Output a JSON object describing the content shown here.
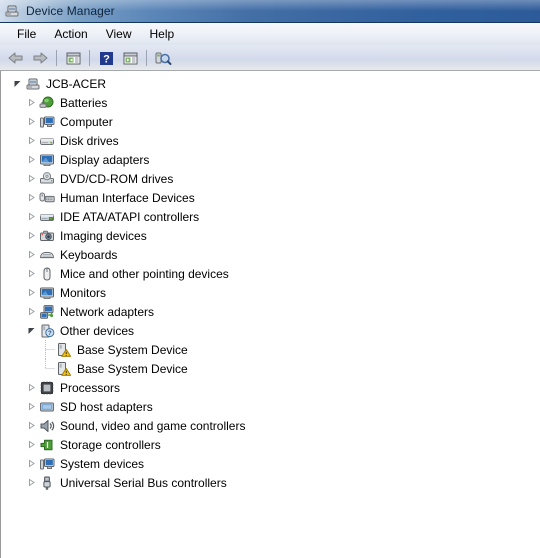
{
  "window": {
    "title": "Device Manager",
    "title_icon": "device-manager-icon"
  },
  "menubar": {
    "items": [
      {
        "label": "File",
        "name": "menu-file"
      },
      {
        "label": "Action",
        "name": "menu-action"
      },
      {
        "label": "View",
        "name": "menu-view"
      },
      {
        "label": "Help",
        "name": "menu-help"
      }
    ]
  },
  "toolbar": {
    "buttons": [
      {
        "icon": "back-arrow-icon",
        "tooltip": "Back"
      },
      {
        "icon": "forward-arrow-icon",
        "tooltip": "Forward"
      },
      {
        "icon": "show-hide-console-tree-icon",
        "tooltip": "Show/Hide Console Tree"
      },
      {
        "icon": "help-icon",
        "tooltip": "Help"
      },
      {
        "icon": "properties-icon",
        "tooltip": "Properties"
      },
      {
        "icon": "scan-hardware-changes-icon",
        "tooltip": "Scan for hardware changes"
      }
    ]
  },
  "tree": {
    "root": {
      "label": "JCB-ACER",
      "icon": "computer-root-icon",
      "expanded": true
    },
    "items": [
      {
        "label": "Batteries",
        "icon": "battery-icon",
        "expanded": false,
        "level": 1
      },
      {
        "label": "Computer",
        "icon": "computer-icon",
        "expanded": false,
        "level": 1
      },
      {
        "label": "Disk drives",
        "icon": "disk-drive-icon",
        "expanded": false,
        "level": 1
      },
      {
        "label": "Display adapters",
        "icon": "display-adapter-icon",
        "expanded": false,
        "level": 1
      },
      {
        "label": "DVD/CD-ROM drives",
        "icon": "dvd-drive-icon",
        "expanded": false,
        "level": 1
      },
      {
        "label": "Human Interface Devices",
        "icon": "hid-icon",
        "expanded": false,
        "level": 1
      },
      {
        "label": "IDE ATA/ATAPI controllers",
        "icon": "ide-controller-icon",
        "expanded": false,
        "level": 1
      },
      {
        "label": "Imaging devices",
        "icon": "imaging-device-icon",
        "expanded": false,
        "level": 1
      },
      {
        "label": "Keyboards",
        "icon": "keyboard-icon",
        "expanded": false,
        "level": 1
      },
      {
        "label": "Mice and other pointing devices",
        "icon": "mouse-icon",
        "expanded": false,
        "level": 1
      },
      {
        "label": "Monitors",
        "icon": "monitor-icon",
        "expanded": false,
        "level": 1
      },
      {
        "label": "Network adapters",
        "icon": "network-adapter-icon",
        "expanded": false,
        "level": 1
      },
      {
        "label": "Other devices",
        "icon": "unknown-device-icon",
        "expanded": true,
        "level": 1
      },
      {
        "label": "Base System Device",
        "icon": "unknown-device-warning-icon",
        "warning": true,
        "level": 2
      },
      {
        "label": "Base System Device",
        "icon": "unknown-device-warning-icon",
        "warning": true,
        "level": 2
      },
      {
        "label": "Processors",
        "icon": "processor-icon",
        "expanded": false,
        "level": 1
      },
      {
        "label": "SD host adapters",
        "icon": "sd-host-adapter-icon",
        "expanded": false,
        "level": 1
      },
      {
        "label": "Sound, video and game controllers",
        "icon": "sound-controller-icon",
        "expanded": false,
        "level": 1
      },
      {
        "label": "Storage controllers",
        "icon": "storage-controller-icon",
        "expanded": false,
        "level": 1
      },
      {
        "label": "System devices",
        "icon": "system-device-icon",
        "expanded": false,
        "level": 1
      },
      {
        "label": "Universal Serial Bus controllers",
        "icon": "usb-controller-icon",
        "expanded": false,
        "level": 1
      }
    ]
  },
  "colors": {
    "titlebar_start": "#cfdcec",
    "titlebar_end": "#2d5b99",
    "help_blue": "#21398c",
    "warning_yellow": "#f5c518",
    "tree_text": "#000000"
  }
}
